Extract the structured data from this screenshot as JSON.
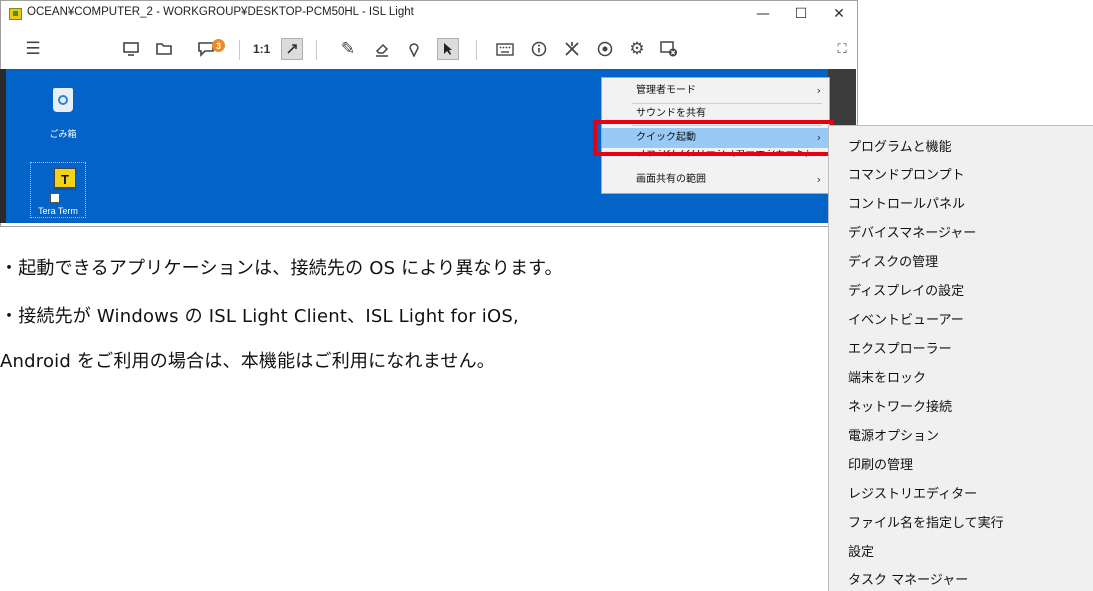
{
  "window": {
    "title": "OCEAN¥COMPUTER_2 - WORKGROUP¥DESKTOP-PCM50HL - ISL Light",
    "controls": {
      "minimize": "—",
      "maximize": "☐",
      "close": "✕"
    }
  },
  "toolbar": {
    "ratio_label": "1:1",
    "chat_badge": "3"
  },
  "desktop": {
    "background": "#0463c6",
    "icons": [
      {
        "label": "ごみ箱"
      },
      {
        "label": "Tera Term",
        "glyph": "T"
      }
    ]
  },
  "context_menu": {
    "items": [
      {
        "label": "管理者モード",
        "arrow": "›"
      },
      {
        "label": "サウンドを共有",
        "arrow": ""
      },
      {
        "label": "クイック起動",
        "arrow": "›"
      },
      {
        "label": "ブランクスクリーン（カーテンモード）",
        "arrow": ""
      },
      {
        "label": "画面共有の範囲",
        "arrow": "›"
      }
    ],
    "highlight_color": "#99c9f5",
    "annotation_color": "#e60012"
  },
  "submenu": {
    "items": [
      "プログラムと機能",
      "コマンドプロンプト",
      "コントロールパネル",
      "デバイスマネージャー",
      "ディスクの管理",
      "ディスプレイの設定",
      "イベントビューアー",
      "エクスプローラー",
      "端末をロック",
      "ネットワーク接続",
      "電源オプション",
      "印刷の管理",
      "レジストリエディター",
      "ファイル名を指定して実行",
      "設定",
      "タスク マネージャー"
    ]
  },
  "notes": [
    "・起動できるアプリケーションは、接続先の OS により異なります。",
    "・接続先が Windows の ISL Light Client、ISL Light for iOS,",
    "Android をご利用の場合は、本機能はご利用になれません。"
  ]
}
